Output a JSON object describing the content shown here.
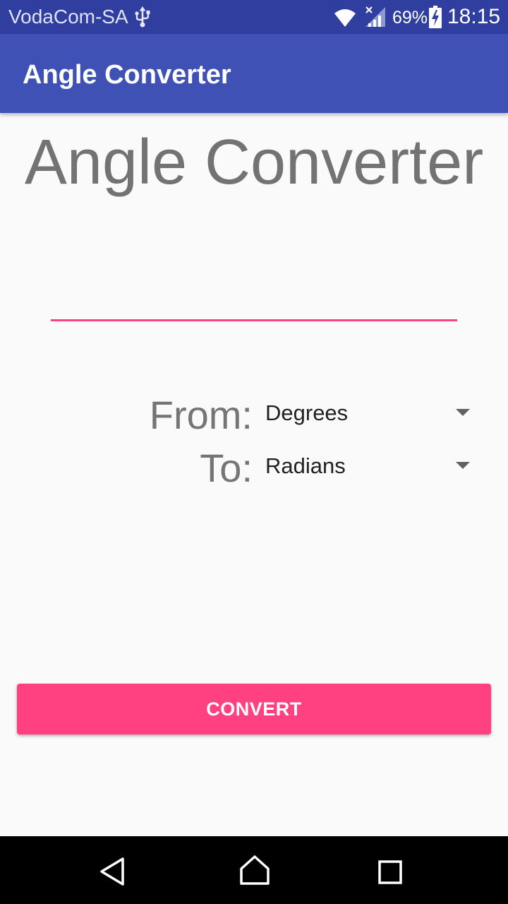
{
  "status_bar": {
    "carrier": "VodaCom-SA",
    "battery_percent": "69%",
    "time": "18:15",
    "icons": [
      "usb-icon",
      "wifi-icon",
      "signal-icon",
      "battery-charging-icon"
    ]
  },
  "app_bar": {
    "title": "Angle Converter",
    "color": "#3f51b5"
  },
  "main": {
    "heading": "Angle Converter",
    "value_input": {
      "value": "",
      "placeholder": ""
    },
    "from": {
      "label": "From:",
      "selected": "Degrees"
    },
    "to": {
      "label": "To:",
      "selected": "Radians"
    },
    "convert_button": {
      "label": "CONVERT",
      "color": "#ff4081"
    }
  },
  "nav_bar": {
    "icons": [
      "back-icon",
      "home-icon",
      "recents-icon"
    ]
  },
  "colors": {
    "primary_dark": "#303f9f",
    "primary": "#3f51b5",
    "accent": "#ff4081",
    "background": "#fafafa"
  }
}
